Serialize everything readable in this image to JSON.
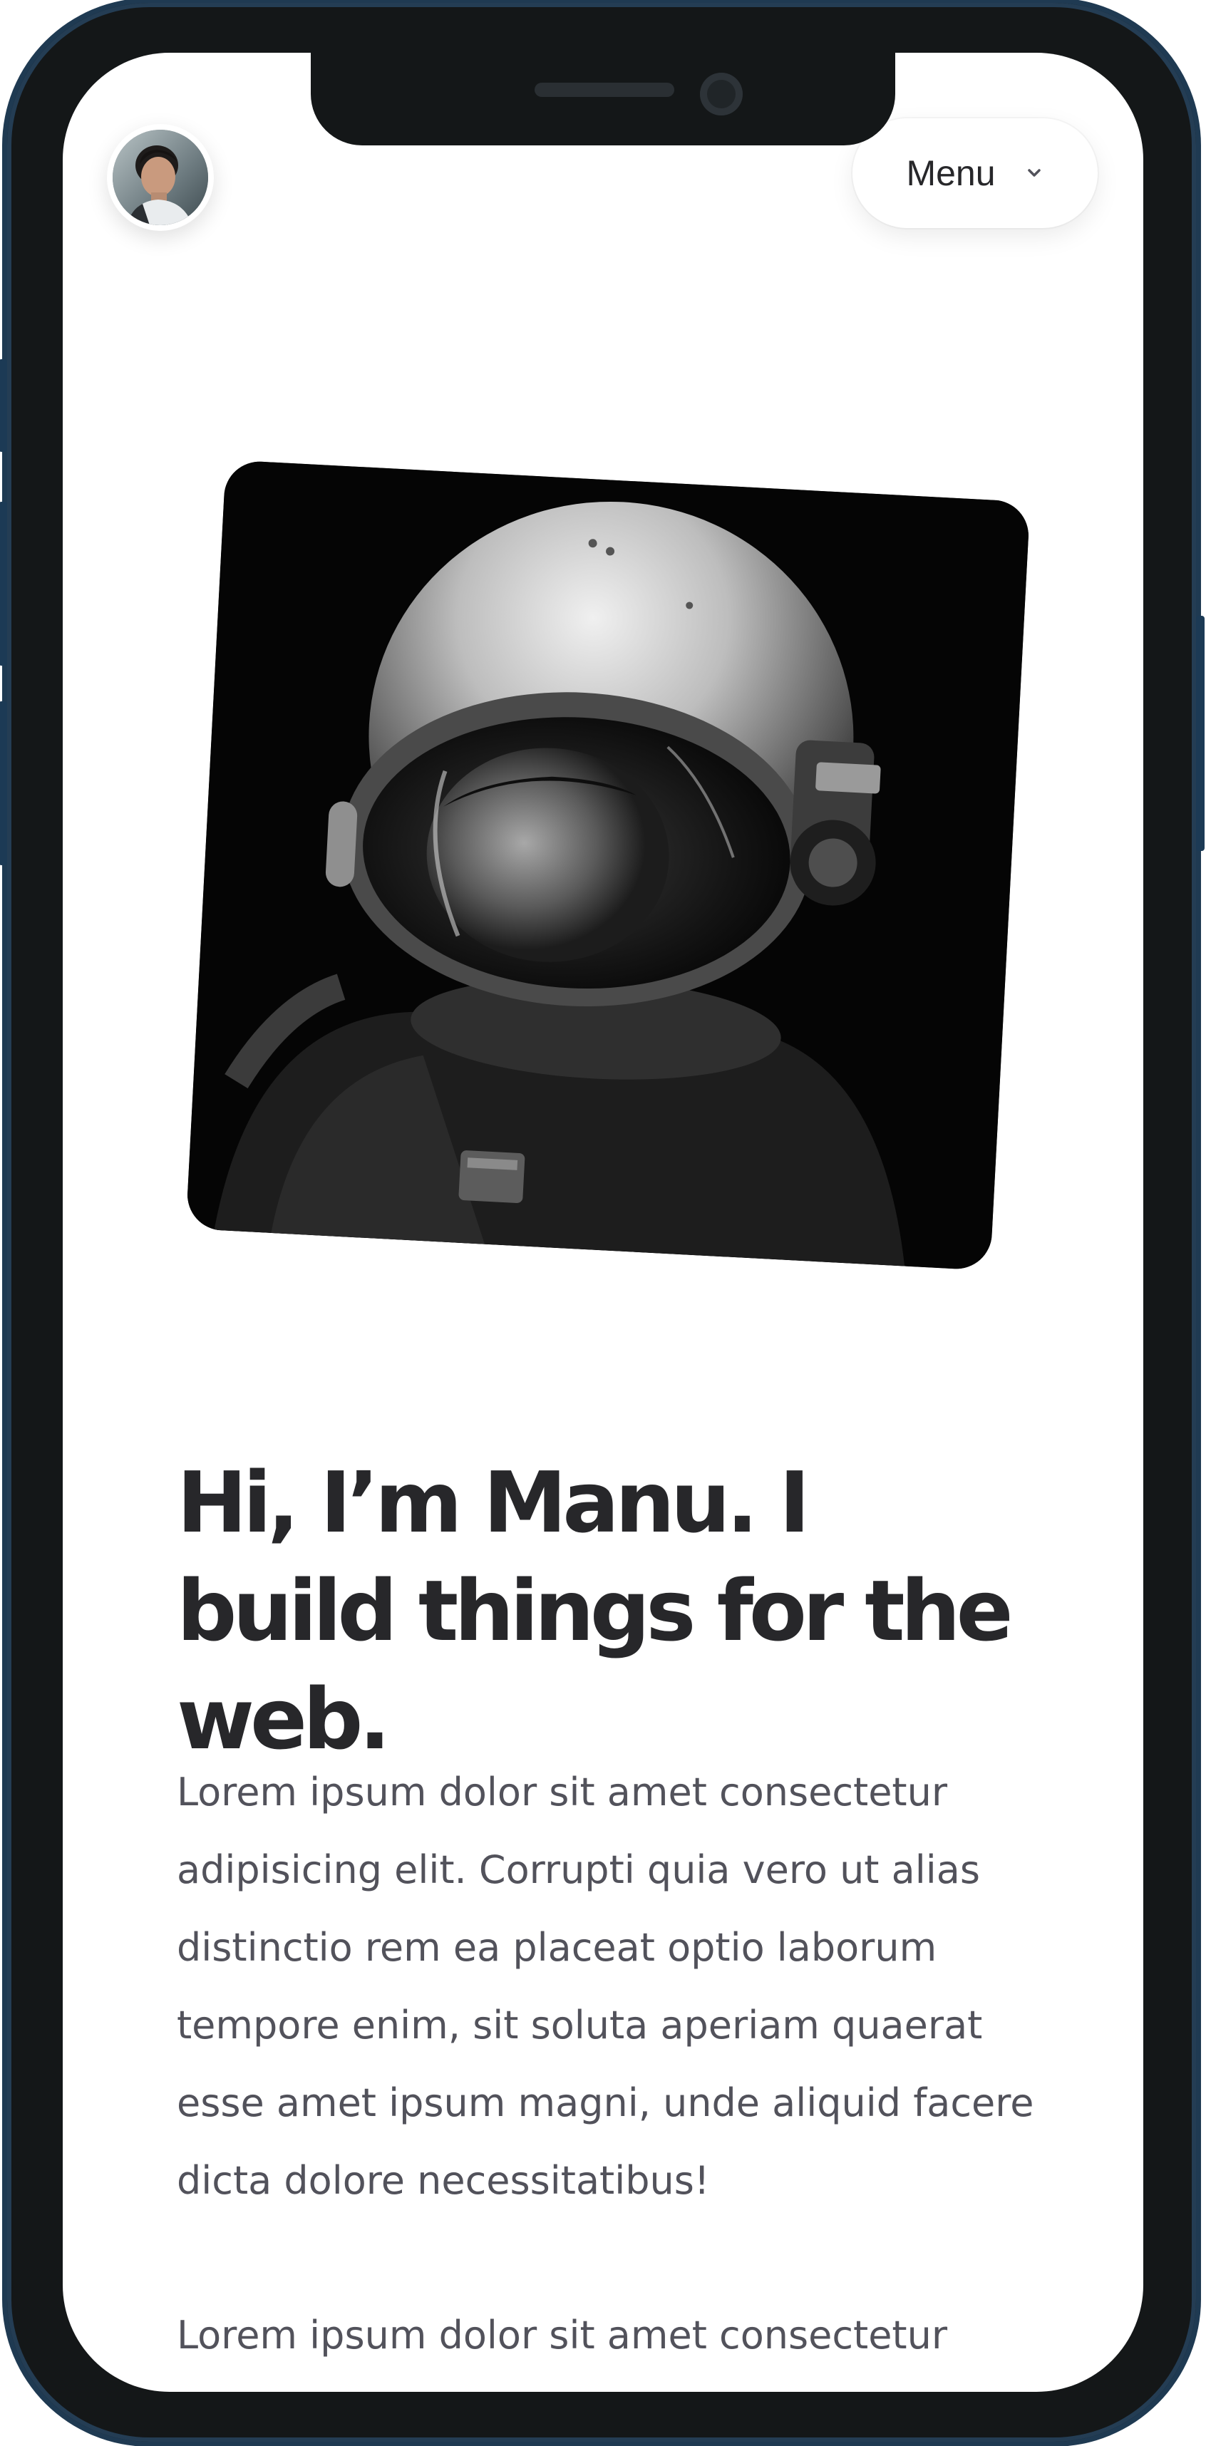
{
  "header": {
    "menu_label": "Menu",
    "avatar_icon": "avatar-photo",
    "menu_chevron_icon": "chevron-down-icon"
  },
  "hero": {
    "image_icon": "astronaut-portrait-photo",
    "headline": "Hi, I’m Manu. I build things for the web.",
    "paragraphs": [
      "Lorem ipsum dolor sit amet consectetur adipisicing elit. Corrupti quia vero ut alias distinctio rem ea placeat optio laborum tempore enim, sit soluta aperiam quaerat esse amet ipsum magni, unde aliquid facere dicta dolore necessitatibus!",
      "Lorem ipsum dolor sit amet consectetur adipisicing elit. Corrupti quia vero ut alias"
    ]
  },
  "colors": {
    "frame": "#141718",
    "frame_edge": "#1f3a52",
    "text_heading": "#27272a",
    "text_body": "#52525b",
    "background": "#ffffff"
  }
}
